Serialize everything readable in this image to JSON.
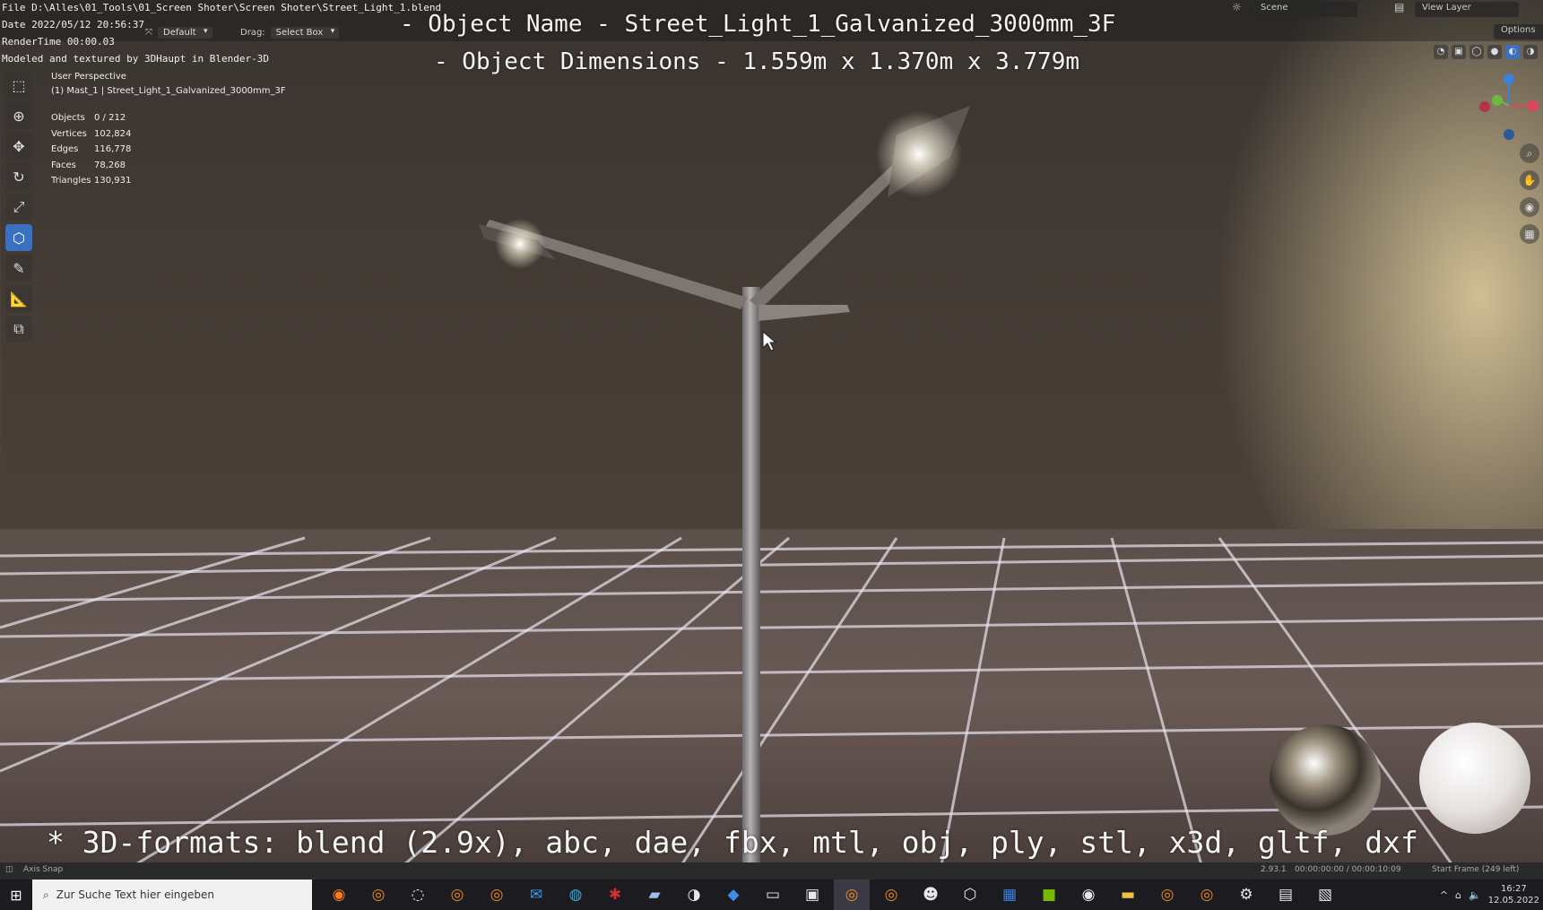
{
  "overlay": {
    "file_path": "File D:\\Alles\\01_Tools\\01_Screen Shoter\\Screen Shoter\\Street_Light_1.blend",
    "date": "Date 2022/05/12 20:56:37",
    "render_time": "RenderTime 00:00.03",
    "credit": "Modeled and textured by 3DHaupt in Blender-3D",
    "object_name": "- Object Name - Street_Light_1_Galvanized_3000mm_3F",
    "object_dims": "- Object Dimensions -  1.559m x 1.370m x 3.779m",
    "formats": "* 3D-formats: blend (2.9x), abc, dae, fbx, mtl, obj, ply, stl, x3d, gltf, dxf"
  },
  "header": {
    "orientation_value": "Default",
    "drag_label": "Drag:",
    "drag_value": "Select Box",
    "scene": "Scene",
    "view_layer": "View Layer",
    "options": "Options"
  },
  "viewport": {
    "perspective": "User Perspective",
    "collection": "(1) Mast_1 | Street_Light_1_Galvanized_3000mm_3F",
    "stats": [
      {
        "k": "Objects",
        "v": "0 / 212"
      },
      {
        "k": "Vertices",
        "v": "102,824"
      },
      {
        "k": "Edges",
        "v": "116,778"
      },
      {
        "k": "Faces",
        "v": "78,268"
      },
      {
        "k": "Triangles",
        "v": "130,931"
      }
    ]
  },
  "statusbar": {
    "left": "Axis Snap",
    "version": "2.93.1",
    "timecode": "00:00:00:00 / 00:00:10:09",
    "start_frame": "Start Frame (249 left)"
  },
  "taskbar": {
    "search_placeholder": "Zur Suche Text hier eingeben",
    "time": "16:27",
    "date": "12.05.2022"
  },
  "colors": {
    "accent": "#3b6fbf",
    "gizmo_x": "#e0455a",
    "gizmo_y": "#6fb83e",
    "gizmo_z": "#3d80e0"
  }
}
